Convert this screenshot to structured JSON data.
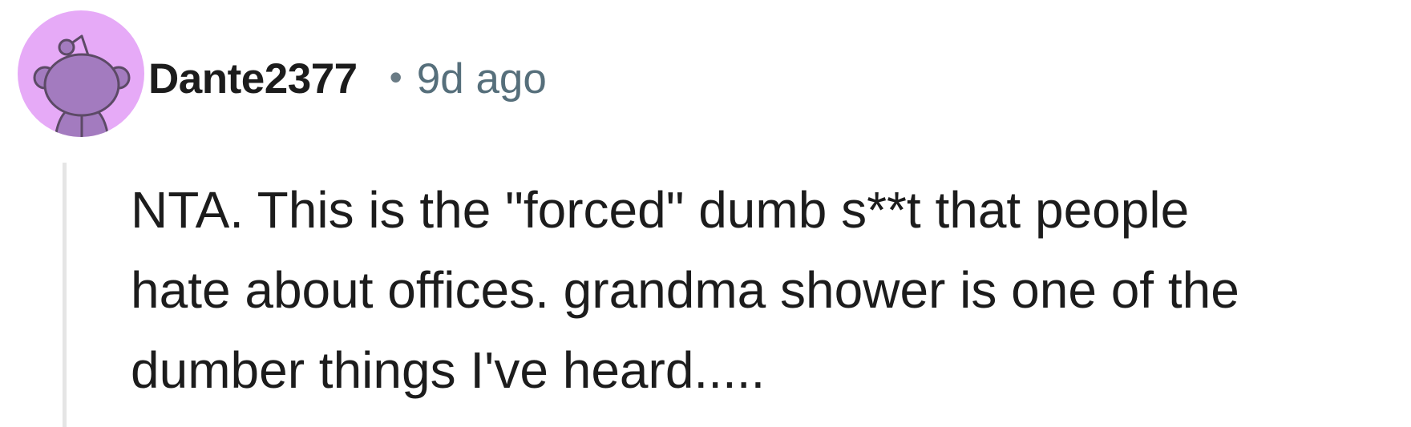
{
  "comment": {
    "author": {
      "username": "Dante2377",
      "avatar_icon": "reddit-snoo-avatar-icon",
      "avatar_bg_color": "#e6aaf7",
      "avatar_fg_color": "#a37bbf"
    },
    "separator": "•",
    "timestamp": "9d ago",
    "body_lines": [
      "NTA. This is the \"forced\" dumb s**t that people",
      "hate about offices. grandma shower is one of the",
      "dumber things I've heard....."
    ]
  }
}
